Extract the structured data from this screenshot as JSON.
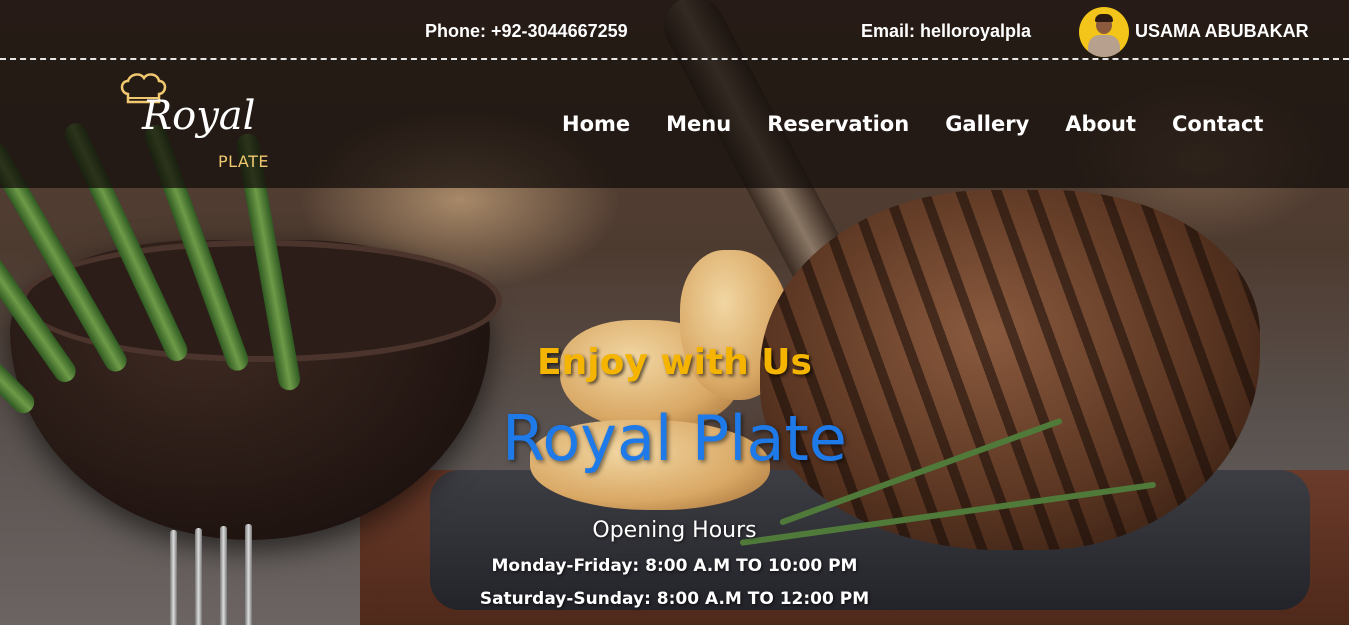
{
  "topbar": {
    "phone": "Phone: +92-3044667259",
    "email": "Email: helloroyalpla",
    "username": "USAMA ABUBAKAR"
  },
  "logo": {
    "line1": "Royal",
    "line2": "PLATE",
    "icon": "chef-hat-icon"
  },
  "nav": {
    "items": [
      "Home",
      "Menu",
      "Reservation",
      "Gallery",
      "About",
      "Contact"
    ]
  },
  "hero": {
    "tagline": "Enjoy with Us",
    "title": "Royal Plate",
    "hours_title": "Opening Hours",
    "hours": [
      "Monday-Friday: 8:00 A.M TO 10:00 PM",
      "Saturday-Sunday: 8:00 A.M TO 12:00 PM"
    ]
  },
  "colors": {
    "tagline": "#f5b400",
    "title": "#1e7ae8",
    "header_bg": "rgba(18,12,10,0.72)",
    "avatar_bg": "#f3c41a",
    "logo_accent": "#f0c870"
  }
}
